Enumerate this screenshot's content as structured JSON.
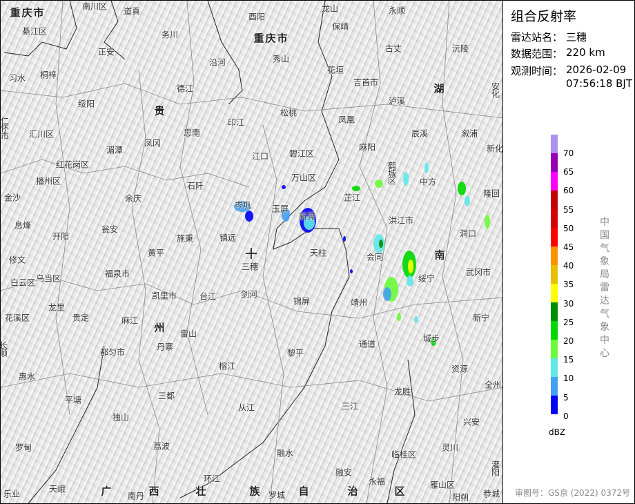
{
  "panel": {
    "title": "组合反射率",
    "station_label": "雷达站名：",
    "station": "三穗",
    "range_label": "数据范围：",
    "range": "220 km",
    "time_label": "观测时间：",
    "date": "2026-02-09",
    "time": "07:56:18 BJT",
    "legend_unit": "dBZ",
    "legend_ticks": [
      "70",
      "65",
      "60",
      "55",
      "50",
      "45",
      "40",
      "35",
      "30",
      "25",
      "20",
      "15",
      "10",
      "5",
      "0"
    ],
    "legend_colors": [
      "#ad90f0",
      "#9600b4",
      "#ff00ff",
      "#c10000",
      "#d60000",
      "#ff0000",
      "#ff9000",
      "#e7c000",
      "#ffff00",
      "#008c00",
      "#00d800",
      "#6cfc3a",
      "#60e8e8",
      "#44a0f0",
      "#0000f6"
    ],
    "credit": "中国气象局雷达气象中心",
    "approval": "审图号：GS京 (2022) 0372号"
  },
  "map": {
    "radar_site": "三穗",
    "labels": [
      "重庆市",
      "南川区",
      "道真",
      "酉阳",
      "龙山",
      "永顺",
      "綦江区",
      "务川",
      "重庆市",
      "保靖",
      "古丈",
      "沅陵",
      "正安",
      "沿河",
      "秀山",
      "花垣",
      "吉首市",
      "湖",
      "安化",
      "习水",
      "桐梓",
      "德江",
      "泸溪",
      "绥阳",
      "贵",
      "松桃",
      "仁怀市",
      "汇川区",
      "思南",
      "印江",
      "凤凰",
      "辰溪",
      "溆浦",
      "凤冈",
      "湄潭",
      "江口",
      "碧江区",
      "麻阳",
      "新化",
      "红花岗区",
      "鹤城区",
      "播州区",
      "石阡",
      "万山区",
      "中方",
      "隆回",
      "金沙",
      "余庆",
      "玉屏",
      "芷江",
      "新晃",
      "岑巩",
      "洪江市",
      "息烽",
      "开阳",
      "瓮安",
      "施秉",
      "镇远",
      "洞口",
      "黄平",
      "天柱",
      "会同",
      "南",
      "武冈市",
      "修文",
      "乌当区",
      "三穗",
      "福泉市",
      "绥宁",
      "白云区",
      "凯里市",
      "台江",
      "剑河",
      "锦屏",
      "靖州",
      "龙里",
      "花溪区",
      "贵定",
      "麻江",
      "州",
      "雷山",
      "新宁",
      "通道",
      "城步",
      "长顺",
      "都匀市",
      "丹寨",
      "黎平",
      "榕江",
      "资源",
      "惠水",
      "全州",
      "三都",
      "龙胜",
      "平塘",
      "从江",
      "三江",
      "兴安",
      "独山",
      "罗甸",
      "荔波",
      "融水",
      "临桂区",
      "灵川",
      "灌阳",
      "环江",
      "融安",
      "永福",
      "雁山区",
      "乐业",
      "天峨",
      "广",
      "南丹",
      "西",
      "壮",
      "族",
      "罗城",
      "自",
      "治",
      "区",
      "阳朔",
      "恭城"
    ]
  }
}
